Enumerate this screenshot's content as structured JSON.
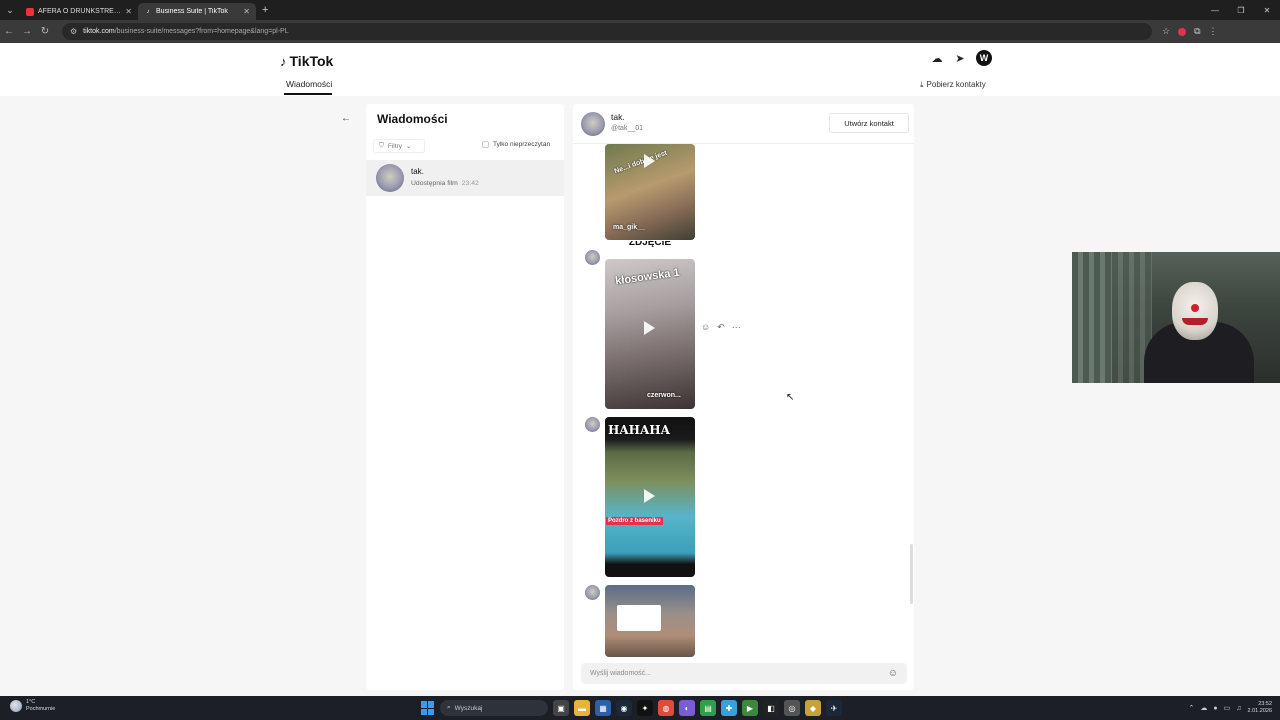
{
  "browser": {
    "tabs": [
      {
        "title": "AFERA O DRUNKSTREAM BRU...",
        "favicon": "youtube-icon",
        "active": false
      },
      {
        "title": "Business Suite | TikTok",
        "favicon": "tiktok-icon",
        "active": true
      }
    ],
    "new_tab": "+",
    "url_host": "tiktok.com",
    "url_path": "/business-suite/messages?from=homepage&lang=pl-PL"
  },
  "header": {
    "logo": "TikTok",
    "nav_messages": "Wiadomości",
    "download_contacts": "Pobierz kontakty",
    "user_initial": "W"
  },
  "inbox": {
    "title": "Wiadomości",
    "filter_label": "Filtry",
    "unread_only": "Tylko nieprzeczytan",
    "conversations": [
      {
        "name": "tak.",
        "preview": "Udostępnia film",
        "time": "23:42"
      }
    ]
  },
  "chat": {
    "name": "tak.",
    "handle": "@tak__01",
    "create_contact": "Utwórz kontakt",
    "videos": [
      {
        "caption_top": "Ne...i dobrze jest",
        "caption_bottom": "ma_gik__"
      },
      {
        "caption_top": "kłosowska 1",
        "caption_bottom": "czerwon..."
      },
      {
        "caption_top": "HAHAHA",
        "caption_mid": "Pozdro z baseniku",
        "caption_bottom": ""
      },
      {
        "caption_top": "",
        "caption_bottom": ""
      }
    ],
    "strip_text": "ZDJĘCIE",
    "composer_placeholder": "Wyślij wiadomość..."
  },
  "taskbar": {
    "temperature": "1°C",
    "weather": "Pochmurnie",
    "search": "Wyszukaj",
    "time": "23:52",
    "date": "2.01.2026"
  },
  "colors": {
    "accent": "#111111",
    "selected_row": "#f0f0f0",
    "page_bg": "#f6f6f6"
  }
}
